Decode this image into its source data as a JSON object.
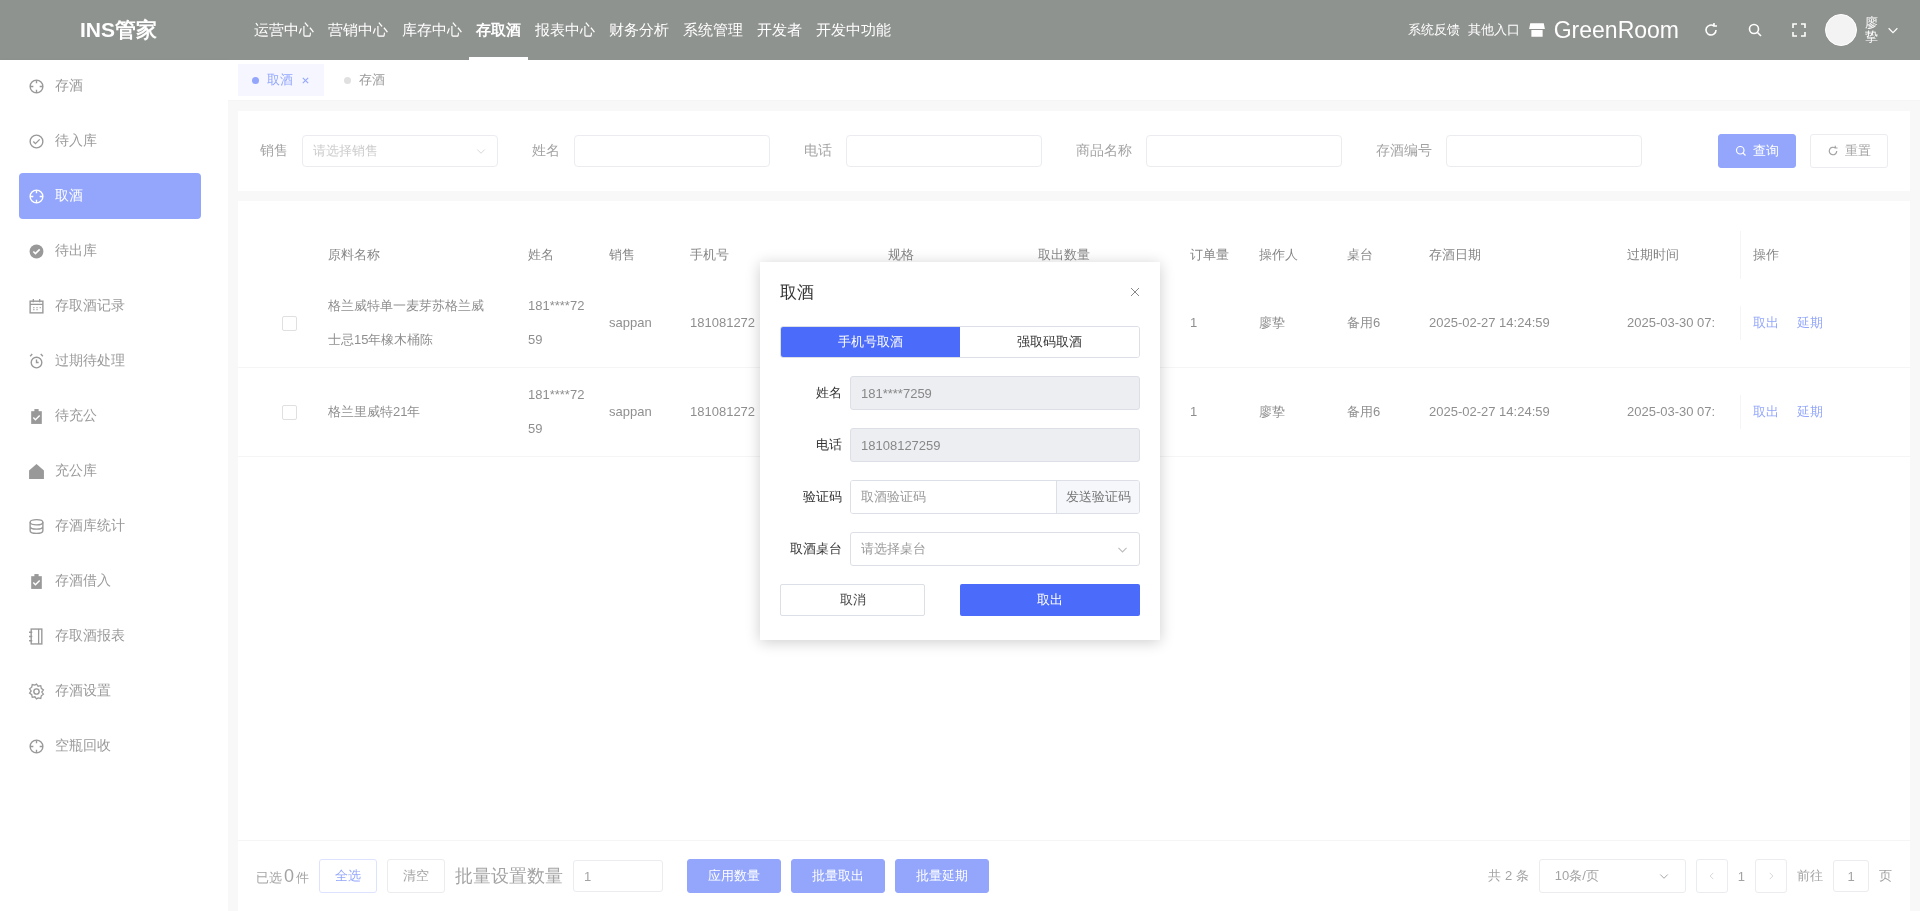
{
  "topbar": {
    "logo": "INS管家",
    "nav": [
      {
        "label": "运营中心",
        "selected": false
      },
      {
        "label": "营销中心",
        "selected": false
      },
      {
        "label": "库存中心",
        "selected": false
      },
      {
        "label": "存取酒",
        "selected": true
      },
      {
        "label": "报表中心",
        "selected": false
      },
      {
        "label": "财务分析",
        "selected": false
      },
      {
        "label": "系统管理",
        "selected": false
      },
      {
        "label": "开发者",
        "selected": false
      },
      {
        "label": "开发中功能",
        "selected": false
      }
    ],
    "links": [
      "系统反馈",
      "其他入口"
    ],
    "store": "GreenRoom",
    "user": "廖挚"
  },
  "sidebar": {
    "items": [
      {
        "label": "存酒",
        "selected": false
      },
      {
        "label": "待入库",
        "selected": false
      },
      {
        "label": "取酒",
        "selected": true
      },
      {
        "label": "待出库",
        "selected": false
      },
      {
        "label": "存取酒记录",
        "selected": false
      },
      {
        "label": "过期待处理",
        "selected": false
      },
      {
        "label": "待充公",
        "selected": false
      },
      {
        "label": "充公库",
        "selected": false
      },
      {
        "label": "存酒库统计",
        "selected": false
      },
      {
        "label": "存酒借入",
        "selected": false
      },
      {
        "label": "存取酒报表",
        "selected": false
      },
      {
        "label": "存酒设置",
        "selected": false
      },
      {
        "label": "空瓶回收",
        "selected": false
      }
    ]
  },
  "tabs": [
    {
      "label": "取酒",
      "selected": true
    },
    {
      "label": "存酒",
      "selected": false
    }
  ],
  "filters": {
    "fields": [
      {
        "label": "销售",
        "kind": "select",
        "placeholder": "请选择销售"
      },
      {
        "label": "姓名",
        "kind": "input"
      },
      {
        "label": "电话",
        "kind": "input"
      },
      {
        "label": "商品名称",
        "kind": "input"
      },
      {
        "label": "存酒编号",
        "kind": "input"
      }
    ],
    "search_button": "查询",
    "reset_button": "重置"
  },
  "table": {
    "columns": [
      "原料名称",
      "姓名",
      "销售",
      "手机号",
      "规格",
      "取出数量",
      "订单量",
      "操作人",
      "桌台",
      "存酒日期",
      "过期时间",
      "操作"
    ],
    "rows": [
      {
        "checked": false,
        "material": "格兰威特单一麦芽苏格兰威士忌15年橡木桶陈",
        "name": "181****7259",
        "sales": "sappan",
        "phone": "181081272",
        "order_qty": "1",
        "operator": "廖挚",
        "table": "备用6",
        "stored": "2025-02-27 14:24:59",
        "expires": "2025-03-30 07:",
        "actions": [
          "取出",
          "延期"
        ]
      },
      {
        "checked": false,
        "material": "格兰里威特21年",
        "name": "181****7259",
        "sales": "sappan",
        "phone": "181081272",
        "order_qty": "1",
        "operator": "廖挚",
        "table": "备用6",
        "stored": "2025-02-27 14:24:59",
        "expires": "2025-03-30 07:",
        "actions": [
          "取出",
          "延期"
        ]
      }
    ]
  },
  "footer": {
    "selected_label": "已选",
    "selected_count": "0",
    "selected_unit": "件",
    "select_all": "全选",
    "clear": "清空",
    "batch_label": "批量设置数量",
    "batch_value": "1",
    "buttons": [
      "应用数量",
      "批量取出",
      "批量延期"
    ],
    "total": "共 2 条",
    "page_size": "10条/页",
    "current_page": "1",
    "goto_label": "前往",
    "goto_value": "1",
    "page_unit": "页"
  },
  "dialog": {
    "title": "取酒",
    "modes": [
      {
        "label": "手机号取酒",
        "selected": true
      },
      {
        "label": "强取码取酒",
        "selected": false
      }
    ],
    "fields": [
      {
        "label": "姓名",
        "kind": "input",
        "value": "181****7259",
        "disabled": true
      },
      {
        "label": "电话",
        "kind": "input",
        "value": "18108127259",
        "disabled": true
      },
      {
        "label": "验证码",
        "kind": "addon",
        "placeholder": "取酒验证码",
        "addon": "发送验证码",
        "disabled": false
      },
      {
        "label": "取酒桌台",
        "kind": "select",
        "placeholder": "请选择桌台",
        "disabled": false
      }
    ],
    "cancel": "取消",
    "confirm": "取出"
  }
}
